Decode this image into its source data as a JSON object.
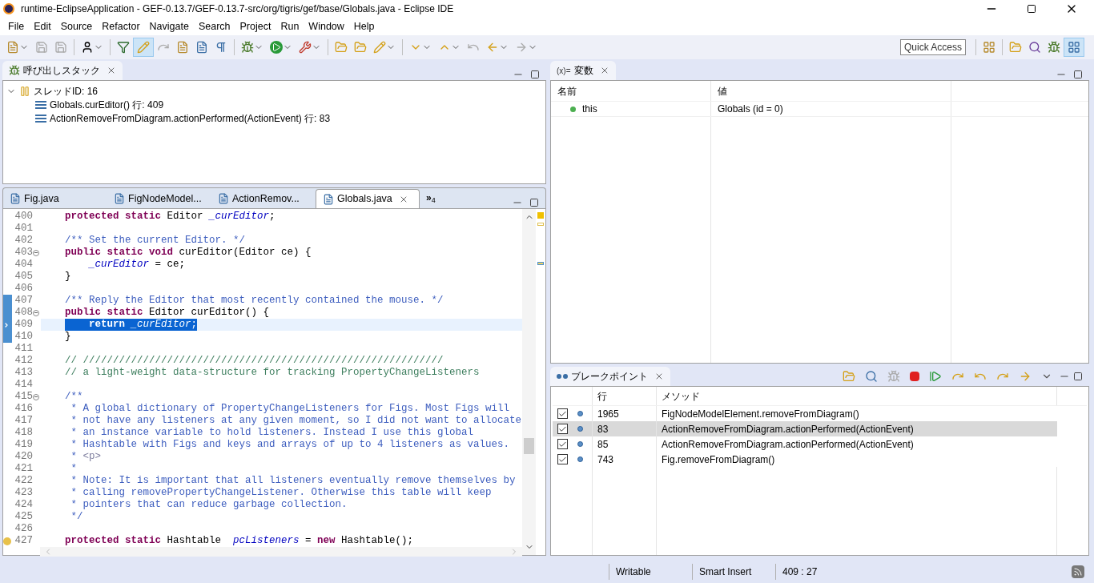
{
  "window": {
    "title": "runtime-EclipseApplication - GEF-0.13.7/GEF-0.13.7-src/org/tigris/gef/base/Globals.java - Eclipse IDE"
  },
  "menu": [
    "File",
    "Edit",
    "Source",
    "Refactor",
    "Navigate",
    "Search",
    "Project",
    "Run",
    "Window",
    "Help"
  ],
  "toolbar": {
    "quick_access": "Quick Access"
  },
  "call_stack": {
    "title": "呼び出しスタック",
    "thread": {
      "label": "スレッドID: 16",
      "expanded": true,
      "children": [
        {
          "label": "Globals.curEditor() 行: 409"
        },
        {
          "label": "ActionRemoveFromDiagram.actionPerformed(ActionEvent) 行: 83"
        }
      ]
    }
  },
  "editor": {
    "tabs": [
      {
        "label": "Fig.java",
        "selected": false
      },
      {
        "label": "FigNodeModel...",
        "selected": false
      },
      {
        "label": "ActionRemov...",
        "selected": false
      },
      {
        "label": "Globals.java",
        "selected": true
      }
    ],
    "overflow": {
      "glyph": "»",
      "count": "4"
    },
    "lines": [
      {
        "number": "400",
        "fold": false,
        "range": false,
        "warning": false,
        "current": false,
        "tokens": [
          {
            "kind": "kw",
            "text": "protected static "
          },
          {
            "kind": "plain",
            "text": "Editor "
          },
          {
            "kind": "field",
            "text": "_curEditor"
          },
          {
            "kind": "plain",
            "text": ";"
          }
        ]
      },
      {
        "number": "401",
        "fold": false,
        "range": false,
        "warning": false,
        "current": false
      },
      {
        "number": "402",
        "fold": false,
        "range": false,
        "warning": false,
        "current": false,
        "tokens": [
          {
            "kind": "javadoc",
            "text": "/** Set the current Editor. */"
          }
        ]
      },
      {
        "number": "403",
        "fold": true,
        "range": false,
        "warning": false,
        "current": false,
        "tokens": [
          {
            "kind": "kw",
            "text": "public static void "
          },
          {
            "kind": "plain",
            "text": "curEditor(Editor ce) {"
          }
        ]
      },
      {
        "number": "404",
        "fold": false,
        "range": false,
        "warning": false,
        "current": false,
        "tokens": [
          {
            "kind": "field",
            "text": "    _curEditor"
          },
          {
            "kind": "plain",
            "text": " = ce;"
          }
        ]
      },
      {
        "number": "405",
        "fold": false,
        "range": false,
        "warning": false,
        "current": false,
        "tokens": [
          {
            "kind": "plain",
            "text": "}"
          }
        ]
      },
      {
        "number": "406",
        "fold": false,
        "range": false,
        "warning": false,
        "current": false
      },
      {
        "number": "407",
        "fold": false,
        "range": true,
        "warning": false,
        "current": false,
        "tokens": [
          {
            "kind": "javadoc",
            "text": "/** Reply the Editor that most recently contained the mouse. */"
          }
        ]
      },
      {
        "number": "408",
        "fold": true,
        "range": true,
        "warning": false,
        "current": false,
        "tokens": [
          {
            "kind": "kw",
            "text": "public static "
          },
          {
            "kind": "plain",
            "text": "Editor curEditor() {"
          }
        ]
      },
      {
        "number": "409",
        "fold": false,
        "range": true,
        "warning": false,
        "current": true,
        "tokens": [
          {
            "kind": "kw",
            "text": "    return "
          },
          {
            "kind": "field",
            "text": "_curEditor"
          },
          {
            "kind": "plain",
            "text": ";"
          }
        ]
      },
      {
        "number": "410",
        "fold": false,
        "range": true,
        "warning": false,
        "current": false,
        "tokens": [
          {
            "kind": "plain",
            "text": "}"
          }
        ]
      },
      {
        "number": "411",
        "fold": false,
        "range": false,
        "warning": false,
        "current": false
      },
      {
        "number": "412",
        "fold": false,
        "range": false,
        "warning": false,
        "current": false,
        "tokens": [
          {
            "kind": "comment",
            "text": "// ////////////////////////////////////////////////////////////"
          }
        ]
      },
      {
        "number": "413",
        "fold": false,
        "range": false,
        "warning": false,
        "current": false,
        "tokens": [
          {
            "kind": "comment",
            "text": "// a light-weight data-structure for tracking PropertyChangeListeners"
          }
        ]
      },
      {
        "number": "414",
        "fold": false,
        "range": false,
        "warning": false,
        "current": false
      },
      {
        "number": "415",
        "fold": true,
        "range": false,
        "warning": false,
        "current": false,
        "tokens": [
          {
            "kind": "javadoc",
            "text": "/**"
          }
        ]
      },
      {
        "number": "416",
        "fold": false,
        "range": false,
        "warning": false,
        "current": false,
        "tokens": [
          {
            "kind": "javadoc",
            "text": " * A global dictionary of PropertyChangeListeners for Figs. Most Figs will"
          }
        ]
      },
      {
        "number": "417",
        "fold": false,
        "range": false,
        "warning": false,
        "current": false,
        "tokens": [
          {
            "kind": "javadoc",
            "text": " * not have any listeners at any given moment, so I did not want to allocate"
          }
        ]
      },
      {
        "number": "418",
        "fold": false,
        "range": false,
        "warning": false,
        "current": false,
        "tokens": [
          {
            "kind": "javadoc",
            "text": " * an instance variable to hold listeners. Instead I use this global"
          }
        ]
      },
      {
        "number": "419",
        "fold": false,
        "range": false,
        "warning": false,
        "current": false,
        "tokens": [
          {
            "kind": "javadoc",
            "text": " * Hashtable with Figs and keys and arrays of up to 4 listeners as values."
          }
        ]
      },
      {
        "number": "420",
        "fold": false,
        "range": false,
        "warning": false,
        "current": false,
        "tokens": [
          {
            "kind": "javadoc",
            "text": " * "
          },
          {
            "kind": "tag",
            "text": "<p>"
          }
        ]
      },
      {
        "number": "421",
        "fold": false,
        "range": false,
        "warning": false,
        "current": false,
        "tokens": [
          {
            "kind": "javadoc",
            "text": " *"
          }
        ]
      },
      {
        "number": "422",
        "fold": false,
        "range": false,
        "warning": false,
        "current": false,
        "tokens": [
          {
            "kind": "javadoc",
            "text": " * Note: It is important that all listeners eventually remove themselves by"
          }
        ]
      },
      {
        "number": "423",
        "fold": false,
        "range": false,
        "warning": false,
        "current": false,
        "tokens": [
          {
            "kind": "javadoc",
            "text": " * calling removePropertyChangeListener. Otherwise this table will keep"
          }
        ]
      },
      {
        "number": "424",
        "fold": false,
        "range": false,
        "warning": false,
        "current": false,
        "tokens": [
          {
            "kind": "javadoc",
            "text": " * pointers that can reduce garbage collection."
          }
        ]
      },
      {
        "number": "425",
        "fold": false,
        "range": false,
        "warning": false,
        "current": false,
        "tokens": [
          {
            "kind": "javadoc",
            "text": " */"
          }
        ]
      },
      {
        "number": "426",
        "fold": false,
        "range": false,
        "warning": false,
        "current": false
      },
      {
        "number": "427",
        "fold": false,
        "range": false,
        "warning": true,
        "current": false,
        "tokens": [
          {
            "kind": "kw",
            "text": "protected static "
          },
          {
            "kind": "plain",
            "text": "Hashtable  "
          },
          {
            "kind": "field",
            "text": "pcListeners"
          },
          {
            "kind": "plain",
            "text": " = "
          },
          {
            "kind": "kw",
            "text": "new "
          },
          {
            "kind": "plain",
            "text": "Hashtable();"
          }
        ]
      }
    ]
  },
  "variables": {
    "title": "変数",
    "title_prefix": "(x)=",
    "columns": [
      "名前",
      "値"
    ],
    "rows": [
      {
        "name": "this",
        "value": "Globals (id = 0)"
      }
    ]
  },
  "breakpoints": {
    "title": "ブレークポイント",
    "columns": [
      "行",
      "メソッド"
    ],
    "rows": [
      {
        "checked": true,
        "selected": false,
        "line": "1965",
        "method": "FigNodeModelElement.removeFromDiagram()"
      },
      {
        "checked": true,
        "selected": true,
        "line": "83",
        "method": "ActionRemoveFromDiagram.actionPerformed(ActionEvent)"
      },
      {
        "checked": true,
        "selected": false,
        "line": "85",
        "method": "ActionRemoveFromDiagram.actionPerformed(ActionEvent)"
      },
      {
        "checked": true,
        "selected": false,
        "line": "743",
        "method": "Fig.removeFromDiagram()"
      }
    ]
  },
  "status_bar": [
    "Writable",
    "Smart Insert",
    "409 : 27"
  ]
}
